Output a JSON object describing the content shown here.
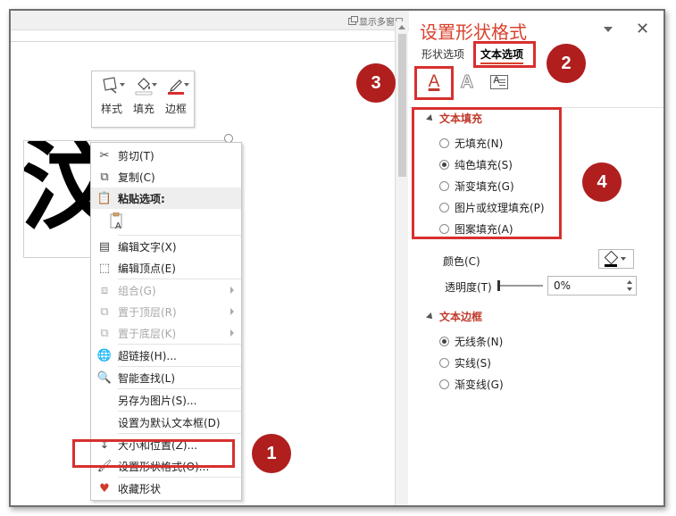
{
  "window": {
    "multi_window_label": "显示多窗口"
  },
  "slide": {
    "big_text": "汶"
  },
  "mini_toolbar": {
    "items": [
      {
        "label": "样式",
        "icon": "style-brush-icon"
      },
      {
        "label": "填充",
        "icon": "fill-bucket-icon"
      },
      {
        "label": "边框",
        "icon": "outline-pen-icon"
      }
    ]
  },
  "context_menu": {
    "items": [
      {
        "label": "剪切(T)",
        "icon": "scissors-icon",
        "enabled": true
      },
      {
        "label": "复制(C)",
        "icon": "copy-icon",
        "enabled": true
      },
      {
        "label": "粘贴选项:",
        "icon": "clipboard-icon",
        "enabled": true,
        "header": true
      },
      {
        "label": "",
        "icon": "paste-text-only-icon",
        "enabled": true
      },
      {
        "label": "编辑文字(X)",
        "icon": "edit-text-icon",
        "enabled": true
      },
      {
        "label": "编辑顶点(E)",
        "icon": "edit-points-icon",
        "enabled": true
      },
      {
        "label": "组合(G)",
        "icon": "group-icon",
        "enabled": false,
        "submenu": true
      },
      {
        "label": "置于顶层(R)",
        "icon": "bring-front-icon",
        "enabled": false,
        "submenu": true
      },
      {
        "label": "置于底层(K)",
        "icon": "send-back-icon",
        "enabled": false,
        "submenu": true
      },
      {
        "label": "超链接(H)...",
        "icon": "hyperlink-icon",
        "enabled": true
      },
      {
        "label": "智能查找(L)",
        "icon": "smart-lookup-icon",
        "enabled": true
      },
      {
        "label": "另存为图片(S)...",
        "icon": "",
        "enabled": true
      },
      {
        "label": "设置为默认文本框(D)",
        "icon": "",
        "enabled": true
      },
      {
        "label": "大小和位置(Z)...",
        "icon": "size-position-icon",
        "enabled": true
      },
      {
        "label": "设置形状格式(O)...",
        "icon": "format-shape-icon",
        "enabled": true
      },
      {
        "label": "收藏形状",
        "icon": "heart-icon",
        "enabled": true
      }
    ]
  },
  "format_pane": {
    "title": "设置形状格式",
    "close_symbol": "✕",
    "tabs": [
      "形状选项",
      "文本选项"
    ],
    "icon_a_label": "A",
    "icon_outline_label": "A",
    "text_fill": {
      "heading": "文本填充",
      "options": [
        {
          "label": "无填充(N)",
          "checked": false
        },
        {
          "label": "纯色填充(S)",
          "checked": true
        },
        {
          "label": "渐变填充(G)",
          "checked": false
        },
        {
          "label": "图片或纹理填充(P)",
          "checked": false
        },
        {
          "label": "图案填充(A)",
          "checked": false
        }
      ],
      "color_label": "颜色(C)",
      "transparency_label": "透明度(T)",
      "transparency_value": "0%"
    },
    "text_outline": {
      "heading": "文本边框",
      "options": [
        {
          "label": "无线条(N)",
          "checked": true
        },
        {
          "label": "实线(S)",
          "checked": false
        },
        {
          "label": "渐变线(G)",
          "checked": false
        }
      ]
    }
  },
  "annotations": {
    "badges": [
      "1",
      "2",
      "3",
      "4"
    ],
    "accent_color": "#d82f2f",
    "badge_color": "#b01e1e"
  }
}
